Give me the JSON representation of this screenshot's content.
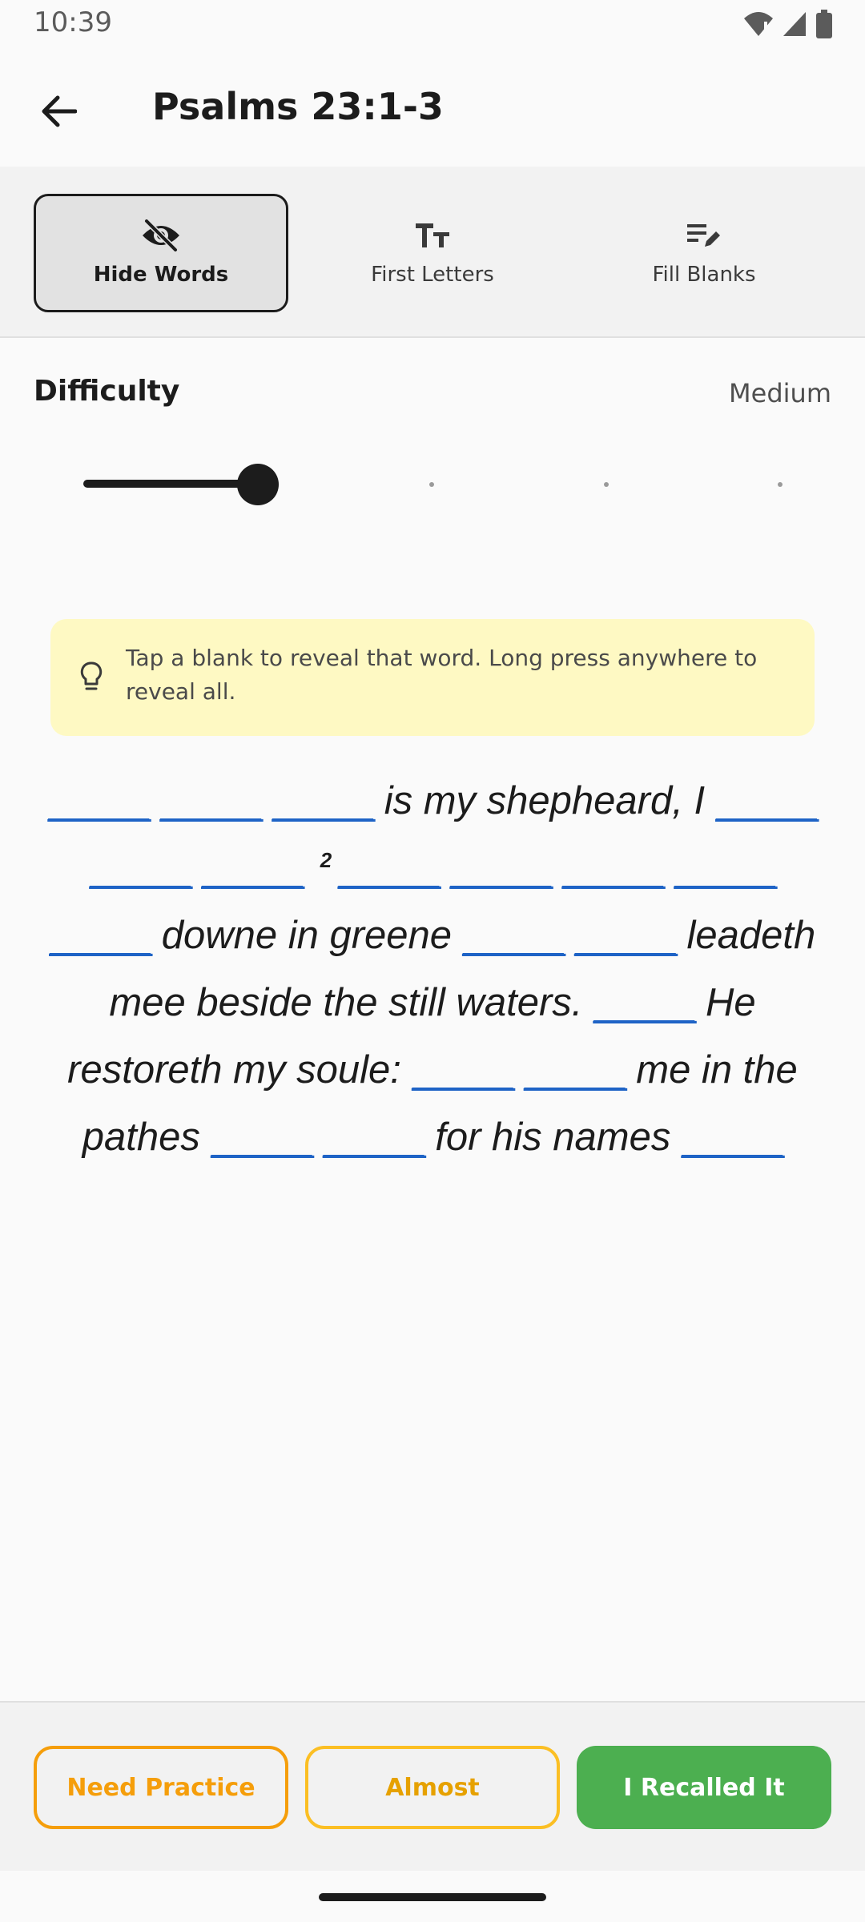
{
  "status_bar": {
    "time": "10:39"
  },
  "header": {
    "title": "Psalms 23:1-3"
  },
  "modes": [
    {
      "label": "Hide Words",
      "icon": "eye-off-icon",
      "active": true
    },
    {
      "label": "First Letters",
      "icon": "text-size-icon",
      "active": false
    },
    {
      "label": "Fill Blanks",
      "icon": "edit-list-icon",
      "active": false
    }
  ],
  "difficulty": {
    "label": "Difficulty",
    "value": "Medium",
    "level": 1,
    "levels": 5
  },
  "hint": {
    "text": "Tap a blank to reveal that word. Long press anywhere to reveal all.",
    "icon": "lightbulb-icon"
  },
  "verse": {
    "blank": "_____",
    "verse_number": "2",
    "segments": [
      "is my shepheard, I",
      "downe in greene",
      "leadeth mee beside the still waters.",
      "He restoreth my soule:",
      "me in the pathes",
      "for his names"
    ]
  },
  "actions": {
    "need_practice": "Need Practice",
    "almost": "Almost",
    "recalled": "I Recalled It"
  },
  "colors": {
    "blank": "#1e63c6",
    "need_practice": "#f59e0b",
    "almost": "#fbbf24",
    "recalled": "#4caf50",
    "hint_bg": "#fef9c3"
  }
}
